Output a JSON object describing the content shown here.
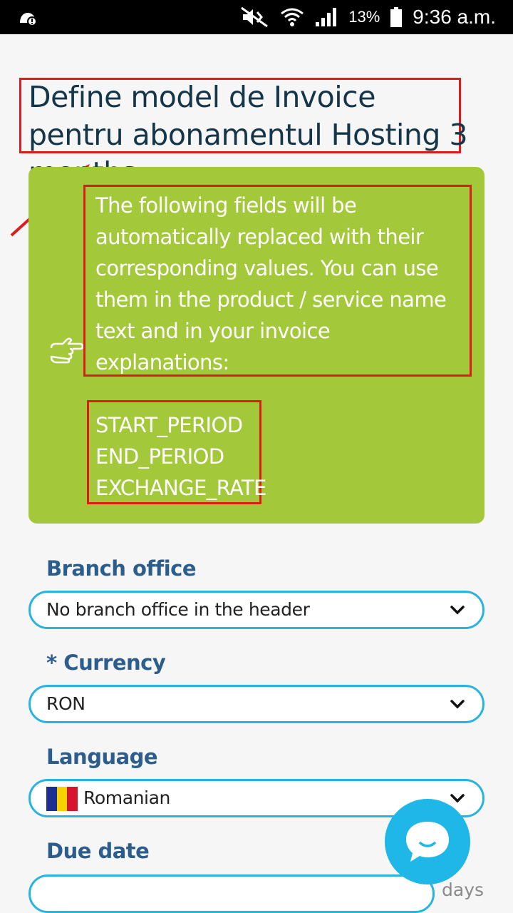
{
  "status_bar": {
    "battery_percent": "13%",
    "time": "9:36 a.m."
  },
  "page": {
    "title": "Define model de Invoice pentru abonamentul Hosting 3 months"
  },
  "info": {
    "description": "The following fields will be automatically replaced with their corresponding values. You can use them in the product / service name text and in your invoice explanations:",
    "variables": [
      "START_PERIOD",
      "END_PERIOD",
      "EXCHANGE_RATE"
    ]
  },
  "form": {
    "branch_office": {
      "label": "Branch office",
      "value": "No branch office in the header"
    },
    "currency": {
      "required_mark": "*",
      "label": "Currency",
      "value": "RON"
    },
    "language": {
      "label": "Language",
      "value": "Romanian"
    },
    "due_date": {
      "label": "Due date",
      "value": "",
      "suffix": "days"
    }
  },
  "colors": {
    "accent": "#28b3e0",
    "info_box": "#a3c93b",
    "label": "#2c5d8c",
    "highlight": "#e01b1b"
  }
}
